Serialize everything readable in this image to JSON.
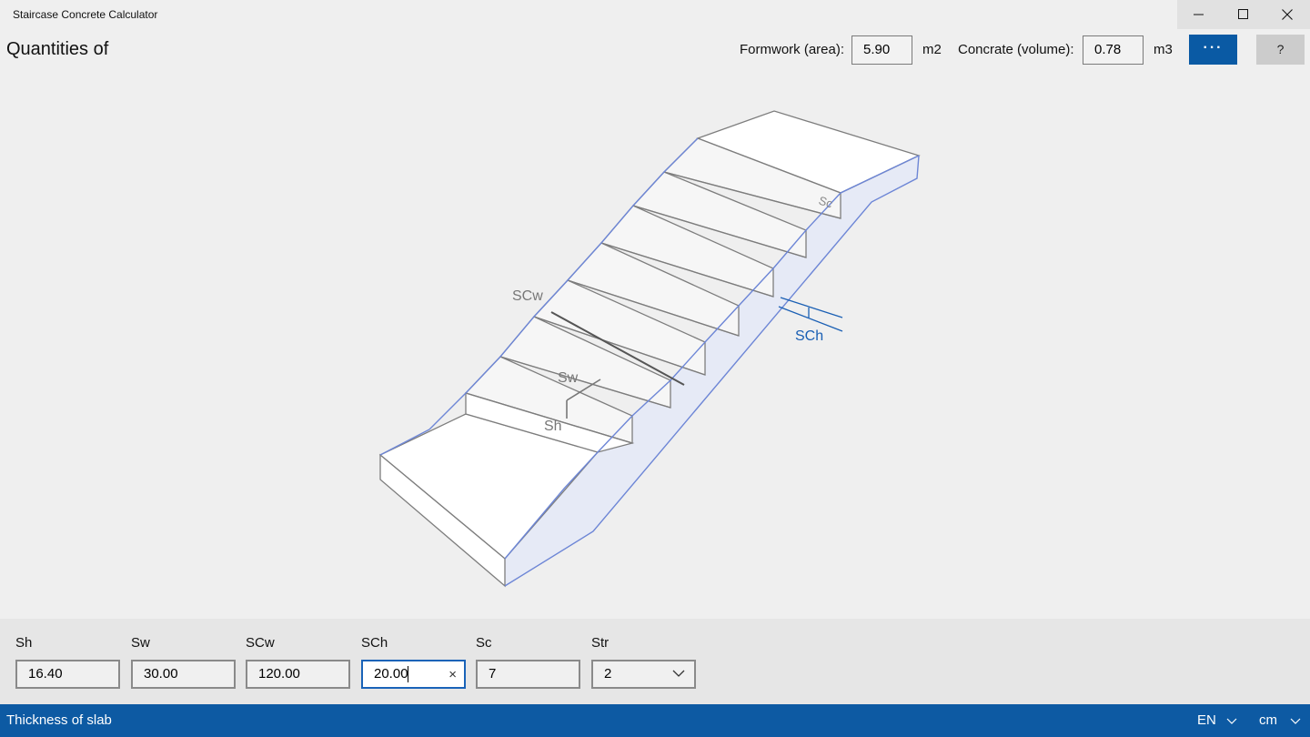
{
  "window": {
    "title": "Staircase Concrete Calculator"
  },
  "header": {
    "title": "Quantities of",
    "formwork_label": "Formwork (area):",
    "formwork_value": "5.90",
    "formwork_unit": "m2",
    "concrete_label": "Concrate (volume):",
    "concrete_value": "0.78",
    "concrete_unit": "m3",
    "more_label": "···",
    "help_label": "?"
  },
  "diagram": {
    "labels": {
      "sc": "Sc",
      "scw": "SCw",
      "sch": "SCh",
      "sw": "Sw",
      "sh": "Sh"
    },
    "colors": {
      "outline": "#7d7d7d",
      "accent": "#6d86d6",
      "side_fill": "#e6eaf6",
      "dim_blue": "#1a5fb4"
    }
  },
  "params": {
    "sh": {
      "label": "Sh",
      "value": "16.40"
    },
    "sw": {
      "label": "Sw",
      "value": "30.00"
    },
    "scw": {
      "label": "SCw",
      "value": "120.00"
    },
    "sch": {
      "label": "SCh",
      "value": "20.00",
      "clear_icon": "×"
    },
    "sc": {
      "label": "Sc",
      "value": "7"
    },
    "str": {
      "label": "Str",
      "value": "2"
    }
  },
  "status": {
    "text": "Thickness of slab",
    "language": "EN",
    "unit": "cm"
  },
  "colors": {
    "accent": "#0a5aa4",
    "statusbar": "#0d5aa3"
  }
}
